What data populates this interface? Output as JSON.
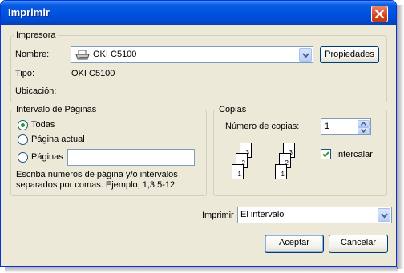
{
  "window": {
    "title": "Imprimir"
  },
  "printer_group": {
    "legend": "Impresora",
    "name_label": "Nombre:",
    "name_value": "OKI C5100",
    "properties_button": "Propiedades",
    "type_label": "Tipo:",
    "type_value": "OKI C5100",
    "location_label": "Ubicación:",
    "location_value": ""
  },
  "range_group": {
    "legend": "Intervalo de Páginas",
    "options": [
      {
        "label": "Todas",
        "selected": true
      },
      {
        "label": "Página actual",
        "selected": false
      },
      {
        "label": "Páginas",
        "selected": false
      }
    ],
    "pages_value": "",
    "hint_line1": "Escriba números de página y/o intervalos",
    "hint_line2": "separados por comas.  Ejemplo, 1,3,5-12"
  },
  "copies_group": {
    "legend": "Copias",
    "count_label": "Número de copias:",
    "count_value": "1",
    "collate_label": "Intercalar",
    "collate_checked": true,
    "page_numbers": [
      "1",
      "2",
      "3"
    ]
  },
  "print_what": {
    "label": "Imprimir",
    "value": "El intervalo"
  },
  "buttons": {
    "ok": "Aceptar",
    "cancel": "Cancelar"
  },
  "icons": {
    "printer": "printer-icon",
    "close": "close-icon",
    "dropdown": "chevron-down-icon"
  }
}
